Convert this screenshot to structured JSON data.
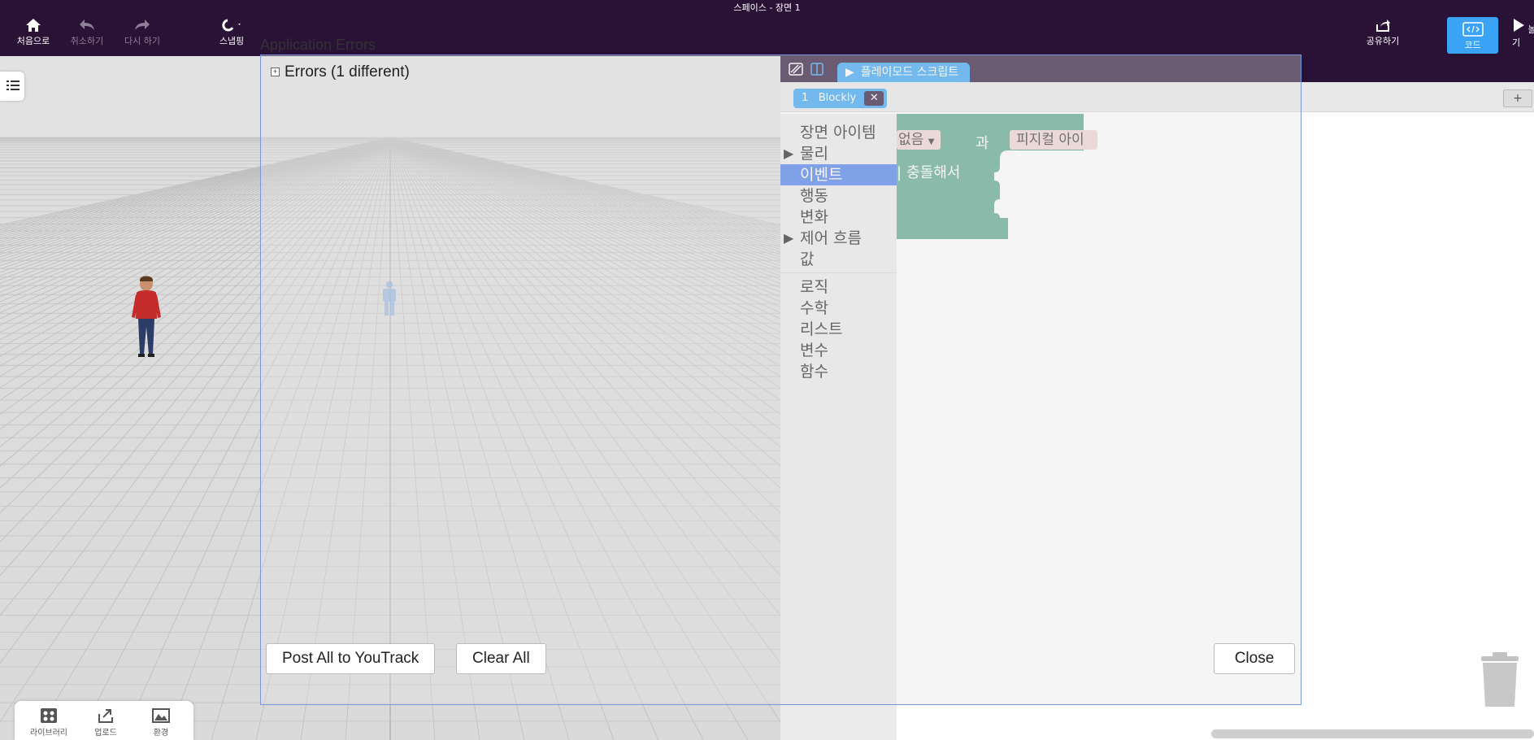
{
  "window": {
    "title": "스페이스 - 장면 1"
  },
  "toolbar": {
    "home_label": "처음으로",
    "undo_label": "취소하기",
    "redo_label": "다시 하기",
    "snap_label": "스냅핑",
    "share_label": "공유하기",
    "code_label": "코드",
    "play_label": "놀기"
  },
  "errors": {
    "window_title": "Application Errors",
    "header": "Errors (1 different)",
    "post_button": "Post All to YouTrack",
    "clear_button": "Clear All",
    "close_button": "Close"
  },
  "editor": {
    "script_tab_label": "플레이모드 스크립트",
    "blockly_tab_number": "1",
    "blockly_tab_label": "Blockly",
    "add_tab_label": "+",
    "categories": [
      {
        "label": "장면 아이템",
        "arrow": ""
      },
      {
        "label": "물리",
        "arrow": "▶"
      },
      {
        "label": "이벤트",
        "arrow": "",
        "selected": true
      },
      {
        "label": "행동",
        "arrow": ""
      },
      {
        "label": "변화",
        "arrow": ""
      },
      {
        "label": "제어 흐름",
        "arrow": "▶"
      },
      {
        "label": "값",
        "arrow": ""
      },
      {
        "label": "로직",
        "arrow": ""
      },
      {
        "label": "수학",
        "arrow": ""
      },
      {
        "label": "리스트",
        "arrow": ""
      },
      {
        "label": "변수",
        "arrow": ""
      },
      {
        "label": "함수",
        "arrow": ""
      }
    ],
    "block": {
      "dropdown1": "없음",
      "and_text": "과",
      "dropdown2": "피지컬 아이",
      "collide_text": "충돌해서",
      "color": "#5ba58c"
    }
  },
  "asset_bar": {
    "library_label": "라이브러리",
    "upload_label": "업로드",
    "environment_label": "환경"
  },
  "colors": {
    "topbar": "#2a1136",
    "accent": "#3aa3f5",
    "selected_category": "#4c7dea",
    "block": "#5ba58c"
  }
}
